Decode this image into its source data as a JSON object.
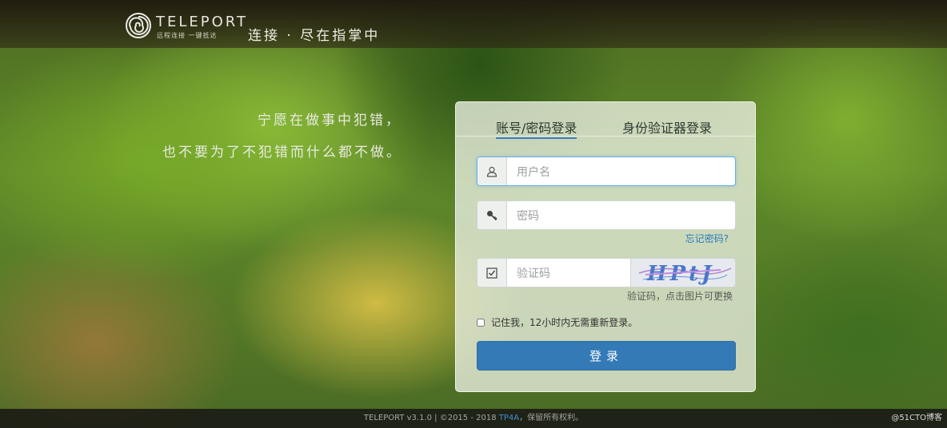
{
  "header": {
    "logo_name": "TELEPORT",
    "logo_subtitle": "远程连接 一键抵达",
    "tagline": "连接 · 尽在指掌中"
  },
  "quote": {
    "line1": "宁愿在做事中犯错，",
    "line2": "也不要为了不犯错而什么都不做。"
  },
  "login": {
    "tabs": [
      {
        "label": "账号/密码登录",
        "active": true
      },
      {
        "label": "身份验证器登录",
        "active": false
      }
    ],
    "username_placeholder": "用户名",
    "password_placeholder": "密码",
    "forgot_password": "忘记密码?",
    "captcha_placeholder": "验证码",
    "captcha_text": "HPtJ",
    "captcha_hint": "验证码，点击图片可更换",
    "remember_label": "记住我，12小时内无需重新登录。",
    "remember_checked": false,
    "submit_label": "登录"
  },
  "footer": {
    "text_prefix": "TELEPORT v3.1.0 | ©2015 - 2018 ",
    "link": "TP4A",
    "text_suffix": "，保留所有权利。",
    "watermark": "@51CTO博客"
  },
  "colors": {
    "accent": "#337ab7",
    "link": "#2a7bbd",
    "tab_underline": "#3d7fc1"
  },
  "icons": {
    "username": "user-icon",
    "password": "key-icon",
    "captcha": "checkbox-icon",
    "logo": "spiral-logo-icon"
  }
}
